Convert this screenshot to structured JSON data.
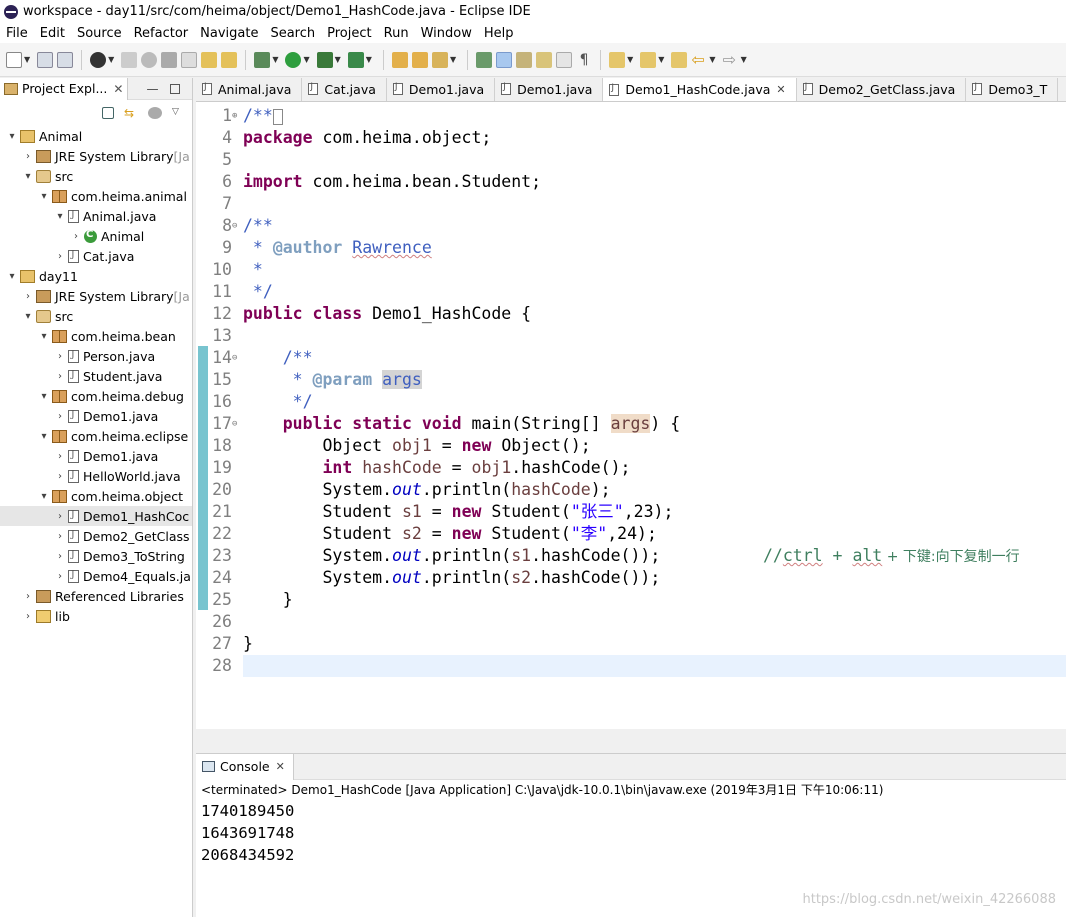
{
  "window": {
    "title": "workspace - day11/src/com/heima/object/Demo1_HashCode.java - Eclipse IDE"
  },
  "menu": [
    "File",
    "Edit",
    "Source",
    "Refactor",
    "Navigate",
    "Search",
    "Project",
    "Run",
    "Window",
    "Help"
  ],
  "explorer": {
    "tab_label": "Project Expl...",
    "tree": [
      {
        "label": "Animal",
        "icon": "project-icon",
        "depth": 0,
        "arrow": "▾"
      },
      {
        "label": "JRE System Library",
        "suffix": " [Ja",
        "icon": "library-icon",
        "depth": 1,
        "arrow": "›"
      },
      {
        "label": "src",
        "icon": "source-folder-icon",
        "depth": 1,
        "arrow": "▾"
      },
      {
        "label": "com.heima.animal",
        "icon": "package-icon",
        "depth": 2,
        "arrow": "▾"
      },
      {
        "label": "Animal.java",
        "icon": "java-file-icon",
        "depth": 3,
        "arrow": "▾"
      },
      {
        "label": "Animal",
        "icon": "class-icon",
        "depth": 4,
        "arrow": "›"
      },
      {
        "label": "Cat.java",
        "icon": "java-file-icon",
        "depth": 3,
        "arrow": "›"
      },
      {
        "label": "day11",
        "icon": "project-icon",
        "depth": 0,
        "arrow": "▾"
      },
      {
        "label": "JRE System Library",
        "suffix": " [Ja",
        "icon": "library-icon",
        "depth": 1,
        "arrow": "›"
      },
      {
        "label": "src",
        "icon": "source-folder-icon",
        "depth": 1,
        "arrow": "▾"
      },
      {
        "label": "com.heima.bean",
        "icon": "package-icon",
        "depth": 2,
        "arrow": "▾"
      },
      {
        "label": "Person.java",
        "icon": "java-file-icon",
        "depth": 3,
        "arrow": "›"
      },
      {
        "label": "Student.java",
        "icon": "java-file-icon",
        "depth": 3,
        "arrow": "›"
      },
      {
        "label": "com.heima.debug",
        "icon": "package-icon",
        "depth": 2,
        "arrow": "▾"
      },
      {
        "label": "Demo1.java",
        "icon": "java-file-icon",
        "depth": 3,
        "arrow": "›"
      },
      {
        "label": "com.heima.eclipse",
        "icon": "package-icon",
        "depth": 2,
        "arrow": "▾"
      },
      {
        "label": "Demo1.java",
        "icon": "java-file-icon",
        "depth": 3,
        "arrow": "›"
      },
      {
        "label": "HelloWorld.java",
        "icon": "java-file-icon",
        "depth": 3,
        "arrow": "›"
      },
      {
        "label": "com.heima.object",
        "icon": "package-icon",
        "depth": 2,
        "arrow": "▾"
      },
      {
        "label": "Demo1_HashCoc",
        "icon": "java-file-icon",
        "depth": 3,
        "arrow": "›",
        "selected": true
      },
      {
        "label": "Demo2_GetClass",
        "icon": "java-file-icon",
        "depth": 3,
        "arrow": "›"
      },
      {
        "label": "Demo3_ToString",
        "icon": "java-file-icon",
        "depth": 3,
        "arrow": "›"
      },
      {
        "label": "Demo4_Equals.ja",
        "icon": "java-file-icon",
        "depth": 3,
        "arrow": "›"
      },
      {
        "label": "Referenced Libraries",
        "icon": "library-icon",
        "depth": 1,
        "arrow": "›"
      },
      {
        "label": "lib",
        "icon": "folder-icon",
        "depth": 1,
        "arrow": "›"
      }
    ]
  },
  "editor_tabs": [
    {
      "label": "Animal.java"
    },
    {
      "label": "Cat.java"
    },
    {
      "label": "Demo1.java"
    },
    {
      "label": "Demo1.java"
    },
    {
      "label": "Demo1_HashCode.java",
      "active": true
    },
    {
      "label": "Demo2_GetClass.java"
    },
    {
      "label": "Demo3_T"
    }
  ],
  "code": {
    "line_numbers": [
      "1",
      "4",
      "5",
      "6",
      "7",
      "8",
      "9",
      "10",
      "11",
      "12",
      "13",
      "14",
      "15",
      "16",
      "17",
      "18",
      "19",
      "20",
      "21",
      "22",
      "23",
      "24",
      "25",
      "26",
      "27",
      "28"
    ],
    "t": {
      "l1": "/**",
      "l4a": "package",
      "l4b": " com.heima.object;",
      "l6a": "import",
      "l6b": " com.heima.bean.Student;",
      "l8": "/**",
      "l9a": " * ",
      "l9b": "@author",
      "l9c": " ",
      "l9d": "Rawrence",
      "l10": " *",
      "l11": " */",
      "l12a": "public",
      "l12b": " ",
      "l12c": "class",
      "l12d": " Demo1_HashCode {",
      "l14": "    /**",
      "l15a": "     * ",
      "l15b": "@param",
      "l15c": " ",
      "l15d": "args",
      "l16": "     */",
      "l17a": "    ",
      "l17b": "public",
      "l17c": " ",
      "l17d": "static",
      "l17e": " ",
      "l17f": "void",
      "l17g": " main(String[] ",
      "l17h": "args",
      "l17i": ") {",
      "l18a": "        Object ",
      "l18b": "obj1",
      "l18c": " = ",
      "l18d": "new",
      "l18e": " Object();",
      "l19a": "        ",
      "l19b": "int",
      "l19c": " ",
      "l19d": "hashCode",
      "l19e": " = ",
      "l19f": "obj1",
      "l19g": ".hashCode();",
      "l20a": "        System.",
      "l20b": "out",
      "l20c": ".println(",
      "l20d": "hashCode",
      "l20e": ");",
      "l21a": "        Student ",
      "l21b": "s1",
      "l21c": " = ",
      "l21d": "new",
      "l21e": " Student(",
      "l21f": "\"张三\"",
      "l21g": ",23);",
      "l22a": "        Student ",
      "l22b": "s2",
      "l22c": " = ",
      "l22d": "new",
      "l22e": " Student(",
      "l22f": "\"李\"",
      "l22g": ",24);",
      "l23a": "        System.",
      "l23b": "out",
      "l23c": ".println(",
      "l23d": "s1",
      "l23e": ".hashCode());",
      "l23f": "//",
      "l23g": "ctrl",
      "l23h": " + ",
      "l23i": "alt",
      "l23j": " + 下键:向下复制一行",
      "l24a": "        System.",
      "l24b": "out",
      "l24c": ".println(",
      "l24d": "s2",
      "l24e": ".hashCode());",
      "l25": "    }",
      "l27": "}"
    }
  },
  "console": {
    "tab_label": "Console",
    "terminated": "<terminated> Demo1_HashCode [Java Application] C:\\Java\\jdk-10.0.1\\bin\\javaw.exe (2019年3月1日 下午10:06:11)",
    "output": [
      "1740189450",
      "1643691748",
      "2068434592"
    ]
  },
  "watermark": "https://blog.csdn.net/weixin_42266088"
}
